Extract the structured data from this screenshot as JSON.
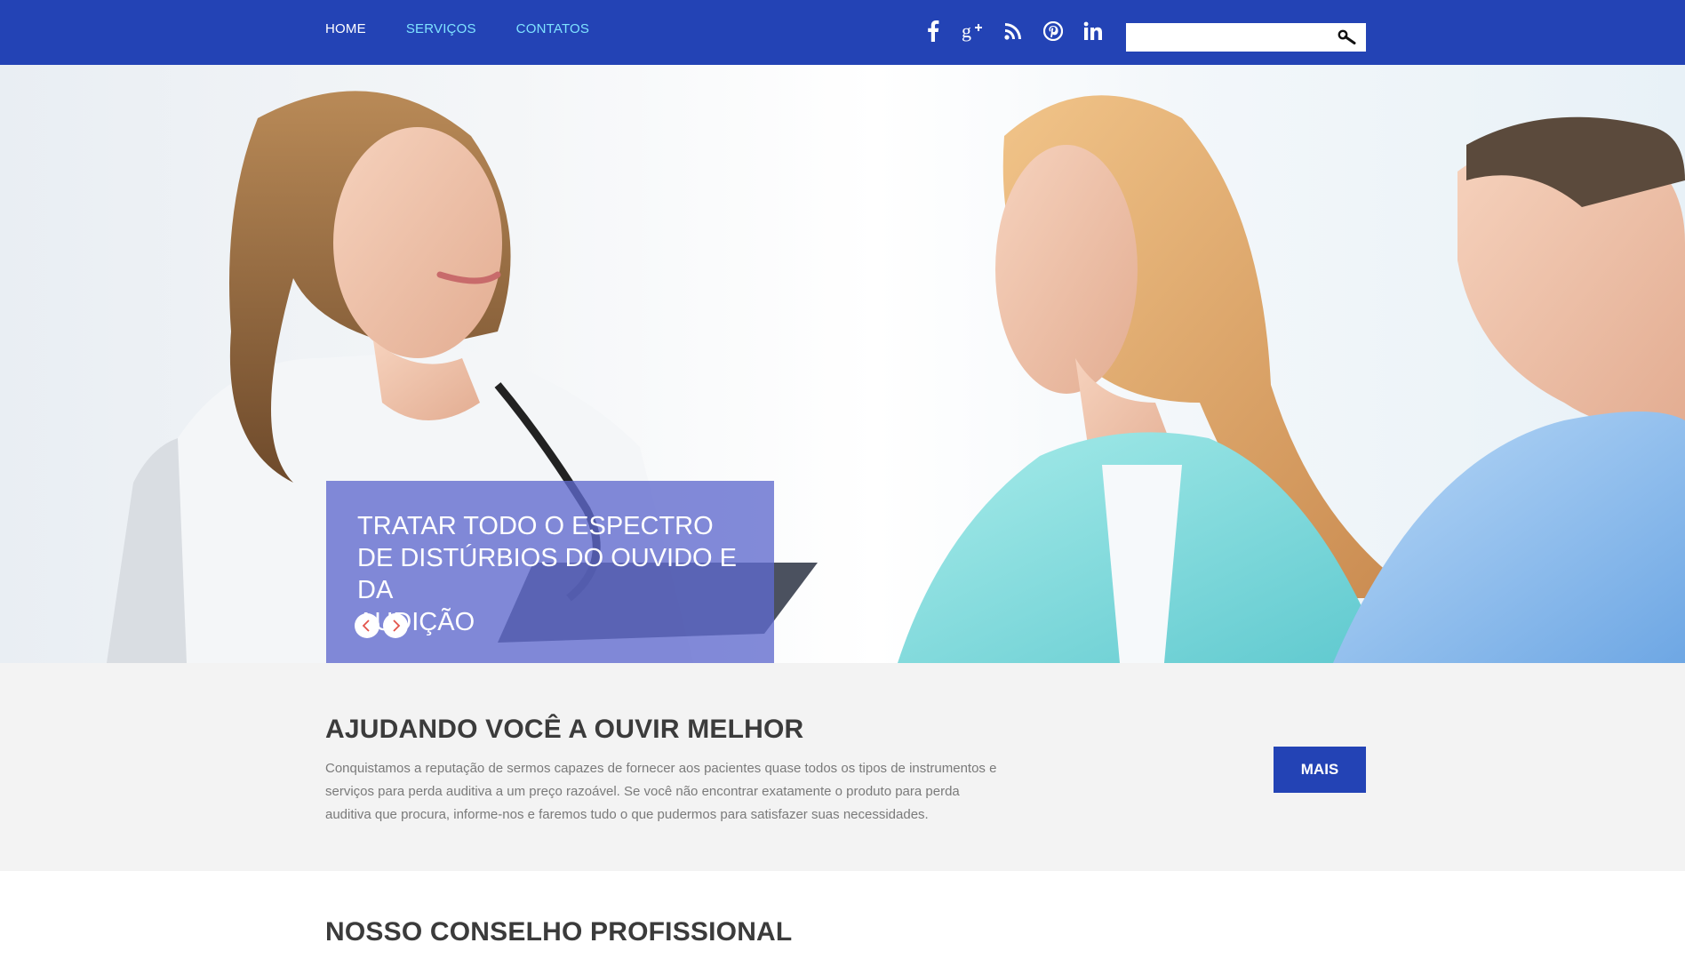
{
  "nav": {
    "items": [
      {
        "label": "HOME",
        "active": true
      },
      {
        "label": "SERVIÇOS",
        "active": false
      },
      {
        "label": "CONTATOS",
        "active": false
      }
    ]
  },
  "social": [
    "facebook-icon",
    "google-plus-icon",
    "rss-icon",
    "pinterest-icon",
    "linkedin-icon"
  ],
  "search": {
    "placeholder": "",
    "value": ""
  },
  "hero": {
    "caption_line1": "TRATAR TODO O ESPECTRO",
    "caption_line2": "DE DISTÚRBIOS DO OUVIDO E DA",
    "caption_line3": "AUDIÇÃO"
  },
  "intro": {
    "title": "AJUDANDO VOCÊ A OUVIR MELHOR",
    "text": "Conquistamos a reputação de sermos capazes de fornecer aos pacientes quase todos os tipos de instrumentos e serviços para perda auditiva a um preço razoável. Se você não encontrar exatamente o produto para perda auditiva que procura, informe-nos e faremos tudo o que pudermos para satisfazer suas necessidades.",
    "button": "MAIS"
  },
  "section2": {
    "title": "NOSSO CONSELHO PROFISSIONAL"
  },
  "colors": {
    "brand": "#2343b5",
    "nav_link": "#7fe3ff",
    "caption_bg": "#5f69cd"
  }
}
